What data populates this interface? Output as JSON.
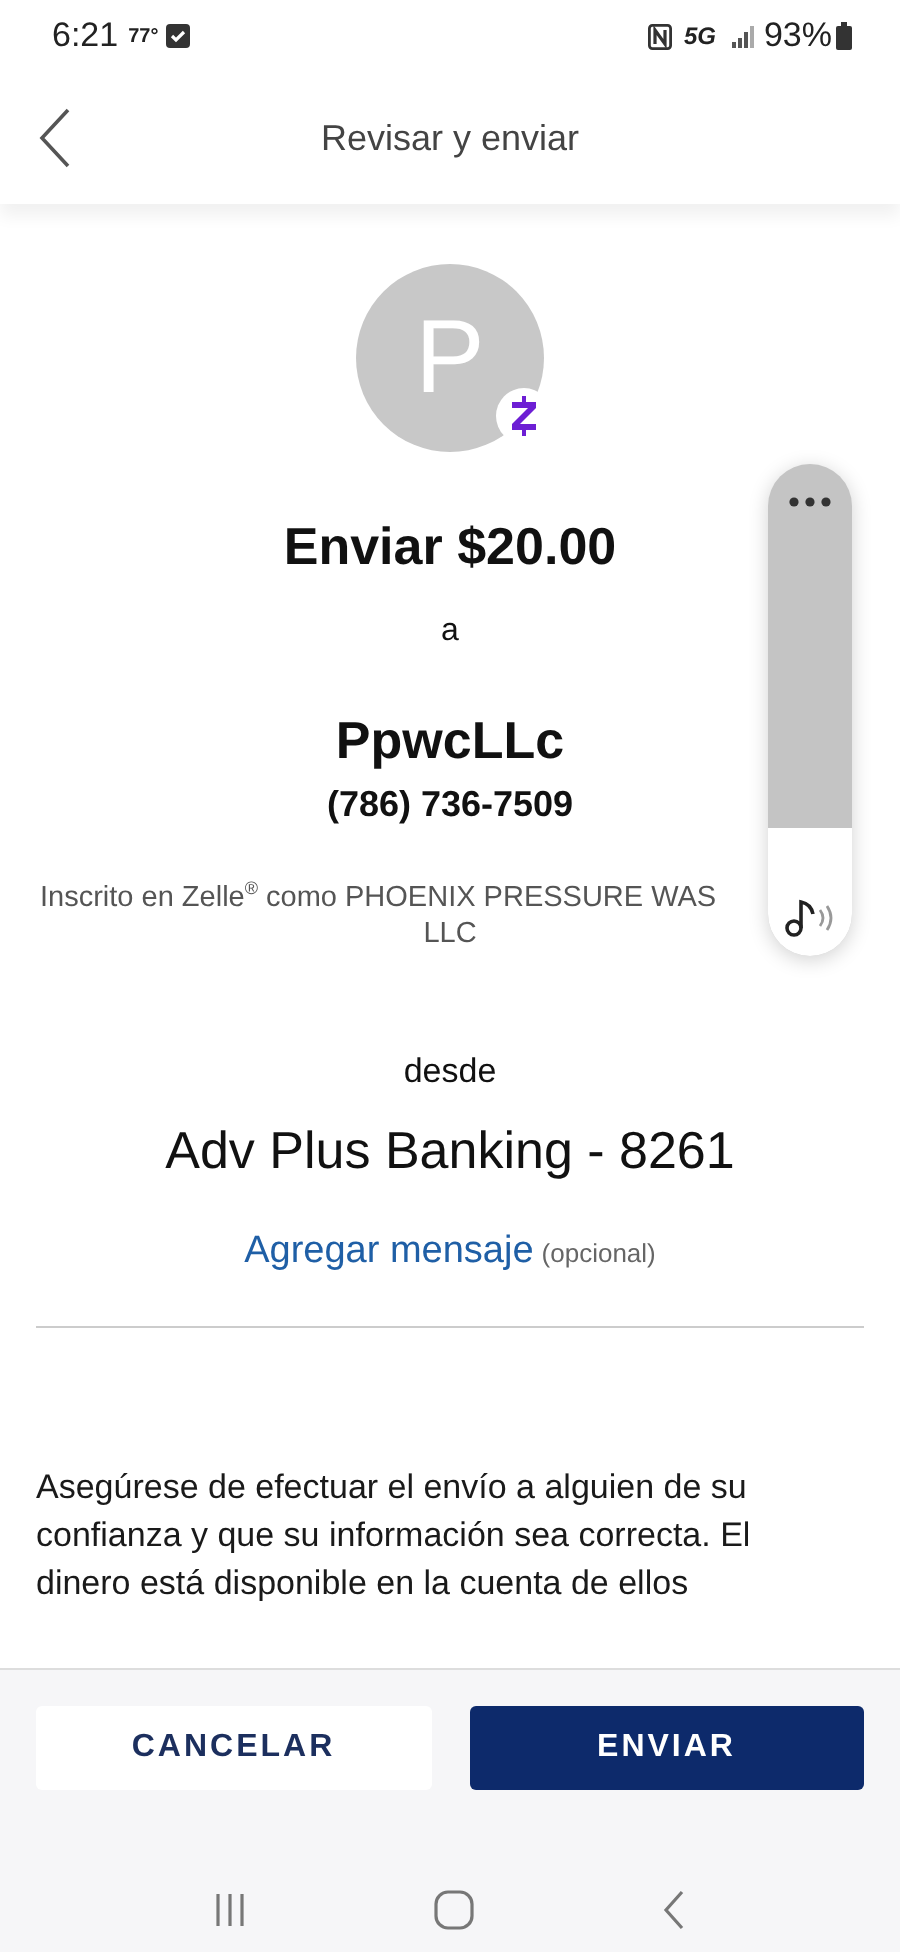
{
  "status_bar": {
    "time": "6:21",
    "temperature": "77°",
    "network": "5G",
    "battery": "93%"
  },
  "header": {
    "title": "Revisar y enviar"
  },
  "recipient": {
    "avatar_initial": "P",
    "amount_line": "Enviar $20.00",
    "connector": "a",
    "name": "PpwcLLc",
    "phone": "(786) 736-7509",
    "enrolled_lines": [
      "Inscrito en Zelle$^{®}$ como PHOENIX PRESSURE WAS",
      "LLC"
    ]
  },
  "source": {
    "label": "desde",
    "account": "Adv Plus Banking - 8261"
  },
  "message_link": {
    "label": "Agregar mensaje",
    "hint": "(opcional)"
  },
  "notice": "Asegúrese de efectuar el envío a alguien de su confianza y que su información sea correcta. El dinero está disponible en la cuenta de ellos",
  "buttons": [
    {
      "label": "CANCELAR",
      "kind": "secondary"
    },
    {
      "label": "ENVIAR",
      "kind": "primary"
    }
  ],
  "volume_panel": {
    "level": 0.26
  }
}
